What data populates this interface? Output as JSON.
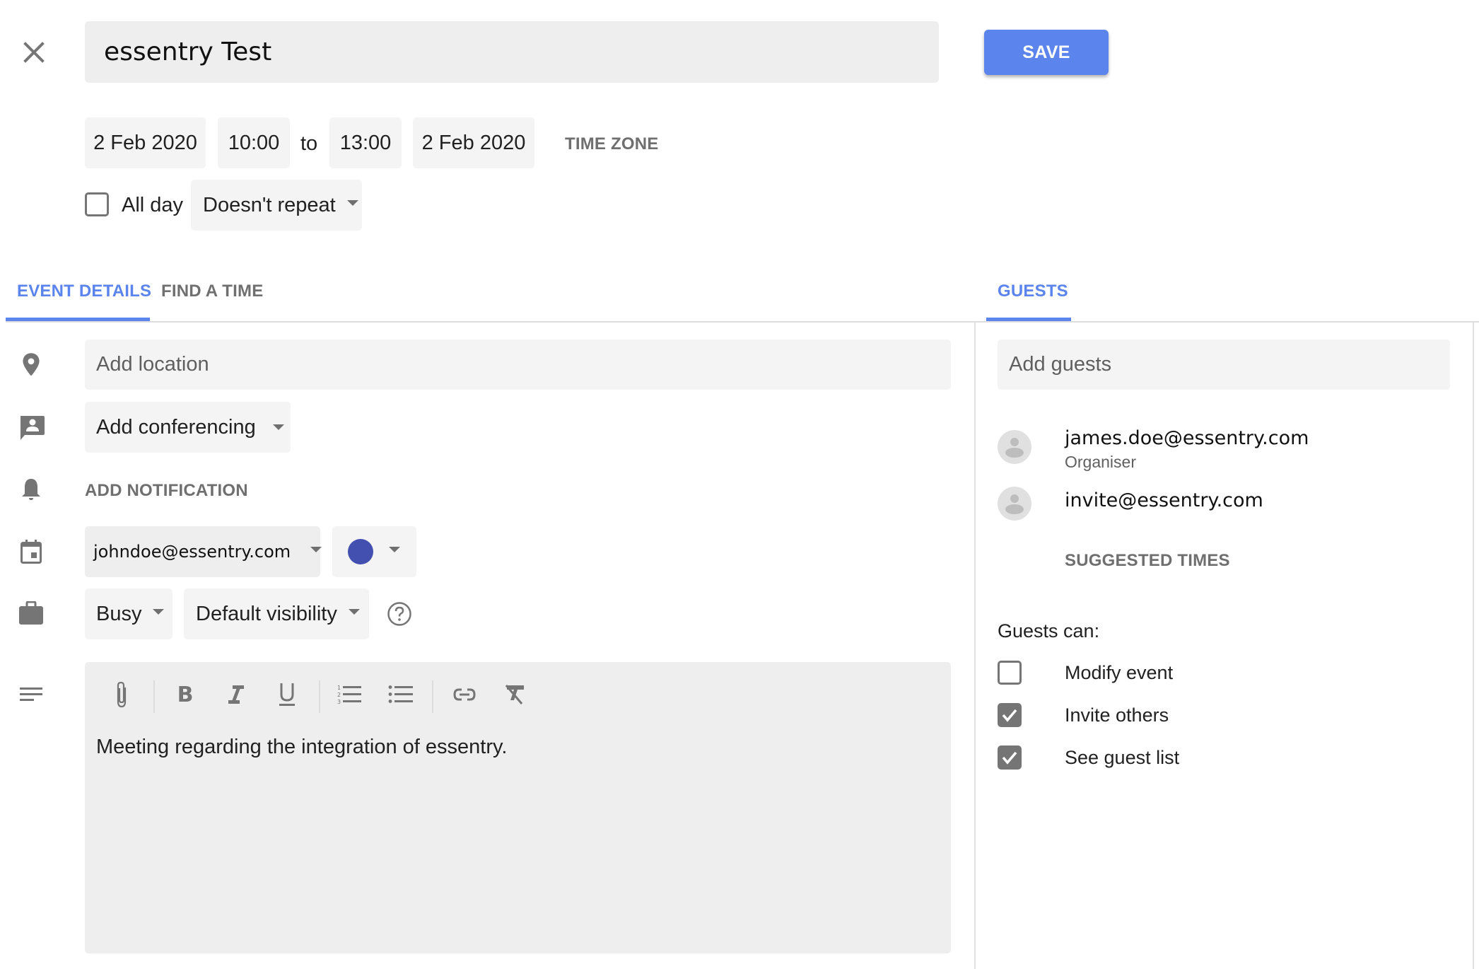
{
  "header": {
    "close_icon": "close-icon",
    "title_value": "essentry Test",
    "save_label": "SAVE"
  },
  "datetime": {
    "start_date": "2 Feb 2020",
    "start_time": "10:00",
    "to_label": "to",
    "end_time": "13:00",
    "end_date": "2 Feb 2020",
    "time_zone_label": "TIME ZONE",
    "all_day_label": "All day",
    "all_day_checked": false,
    "repeat_value": "Doesn't repeat"
  },
  "tabs": {
    "event_details": "EVENT DETAILS",
    "find_a_time": "FIND A TIME",
    "guests": "GUESTS",
    "active": "event_details"
  },
  "details": {
    "location_placeholder": "Add location",
    "conferencing_label": "Add conferencing",
    "add_notification_label": "ADD NOTIFICATION",
    "calendar_value": "johndoe@essentry.com",
    "event_color": "#4350af",
    "availability_value": "Busy",
    "visibility_value": "Default visibility",
    "description_text": "Meeting regarding the integration of essentry.",
    "toolbar": [
      "attachment",
      "bold",
      "italic",
      "underline",
      "numbered-list",
      "bulleted-list",
      "link",
      "remove-formatting"
    ]
  },
  "guests": {
    "add_guests_placeholder": "Add guests",
    "list": [
      {
        "email": "james.doe@essentry.com",
        "role": "Organiser"
      },
      {
        "email": "invite@essentry.com",
        "role": ""
      }
    ],
    "suggested_times_label": "SUGGESTED TIMES",
    "permissions_heading": "Guests can:",
    "permissions": [
      {
        "label": "Modify event",
        "checked": false
      },
      {
        "label": "Invite others",
        "checked": true
      },
      {
        "label": "See guest list",
        "checked": true
      }
    ]
  },
  "colors": {
    "accent": "#5b84ec",
    "icon_gray": "#757575",
    "field_bg": "#f4f4f4"
  }
}
